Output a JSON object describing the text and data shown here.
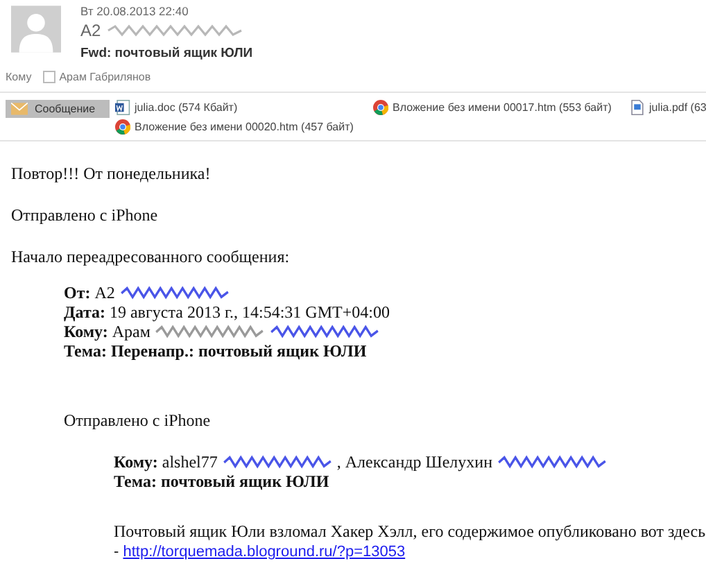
{
  "header": {
    "date": "Вт 20.08.2013 22:40",
    "sender": "А2",
    "sender_redacted": {
      "color": "#b8b8b8"
    },
    "subject": "Fwd: почтовый ящик ЮЛИ",
    "to_label": "Кому",
    "recipients": [
      {
        "name": "Арам Габрилянов",
        "checked": false
      }
    ]
  },
  "tabs": [
    {
      "label": "Сообщение",
      "selected": true
    }
  ],
  "attachments": [
    {
      "kind": "word",
      "name": "julia.doc (574 Кбайт)"
    },
    {
      "kind": "browser",
      "name": "Вложение без имени 00017.htm (553 байт)"
    },
    {
      "kind": "pdf",
      "name": "julia.pdf (63"
    },
    {
      "kind": "browser",
      "name": "Вложение без имени 00020.htm (457 байт)"
    }
  ],
  "body": [
    {
      "kind": "para",
      "text": "Повтор!!! От понедельника!"
    },
    {
      "kind": "para",
      "text": "Отправлено с iPhone"
    },
    {
      "kind": "para",
      "text": "Начало переадресованного сообщения:"
    },
    {
      "kind": "quote",
      "children": [
        {
          "kind": "headers",
          "lines": [
            {
              "label": "От:",
              "parts": [
                {
                  "kind": "text",
                  "text": "А2"
                },
                {
                  "kind": "redacted",
                  "color": "#4a55e8"
                }
              ]
            },
            {
              "label": "Дата:",
              "parts": [
                {
                  "kind": "text",
                  "text": "19 августа 2013 г., 14:54:31 GMT+04:00"
                }
              ]
            },
            {
              "label": "Кому:",
              "parts": [
                {
                  "kind": "text",
                  "text": "Арам"
                },
                {
                  "kind": "redacted",
                  "color": "#9a9a9a"
                },
                {
                  "kind": "redacted",
                  "color": "#4a55e8"
                }
              ]
            },
            {
              "label": "Тема:",
              "parts": [
                {
                  "kind": "bold",
                  "text": "Перенапр.: почтовый ящик ЮЛИ"
                }
              ]
            }
          ]
        },
        {
          "kind": "para",
          "text": "Отправлено с iPhone"
        },
        {
          "kind": "quote",
          "children": [
            {
              "kind": "headers",
              "lines": [
                {
                  "label": "Кому:",
                  "parts": [
                    {
                      "kind": "text",
                      "text": "alshel77"
                    },
                    {
                      "kind": "redacted",
                      "color": "#4a55e8"
                    },
                    {
                      "kind": "text",
                      "text": ", Александр Шелухин"
                    },
                    {
                      "kind": "redacted",
                      "color": "#4a55e8"
                    }
                  ]
                },
                {
                  "label": "Тема:",
                  "parts": [
                    {
                      "kind": "bold",
                      "text": "почтовый ящик ЮЛИ"
                    }
                  ]
                }
              ]
            },
            {
              "kind": "linkpara",
              "text": "Почтовый ящик Юли взломал Хакер Хэлл, его содержимое опубликовано вот здесь",
              "prefix": "-",
              "link": "http://torquemada.bloground.ru/?p=13053"
            }
          ]
        }
      ]
    }
  ]
}
